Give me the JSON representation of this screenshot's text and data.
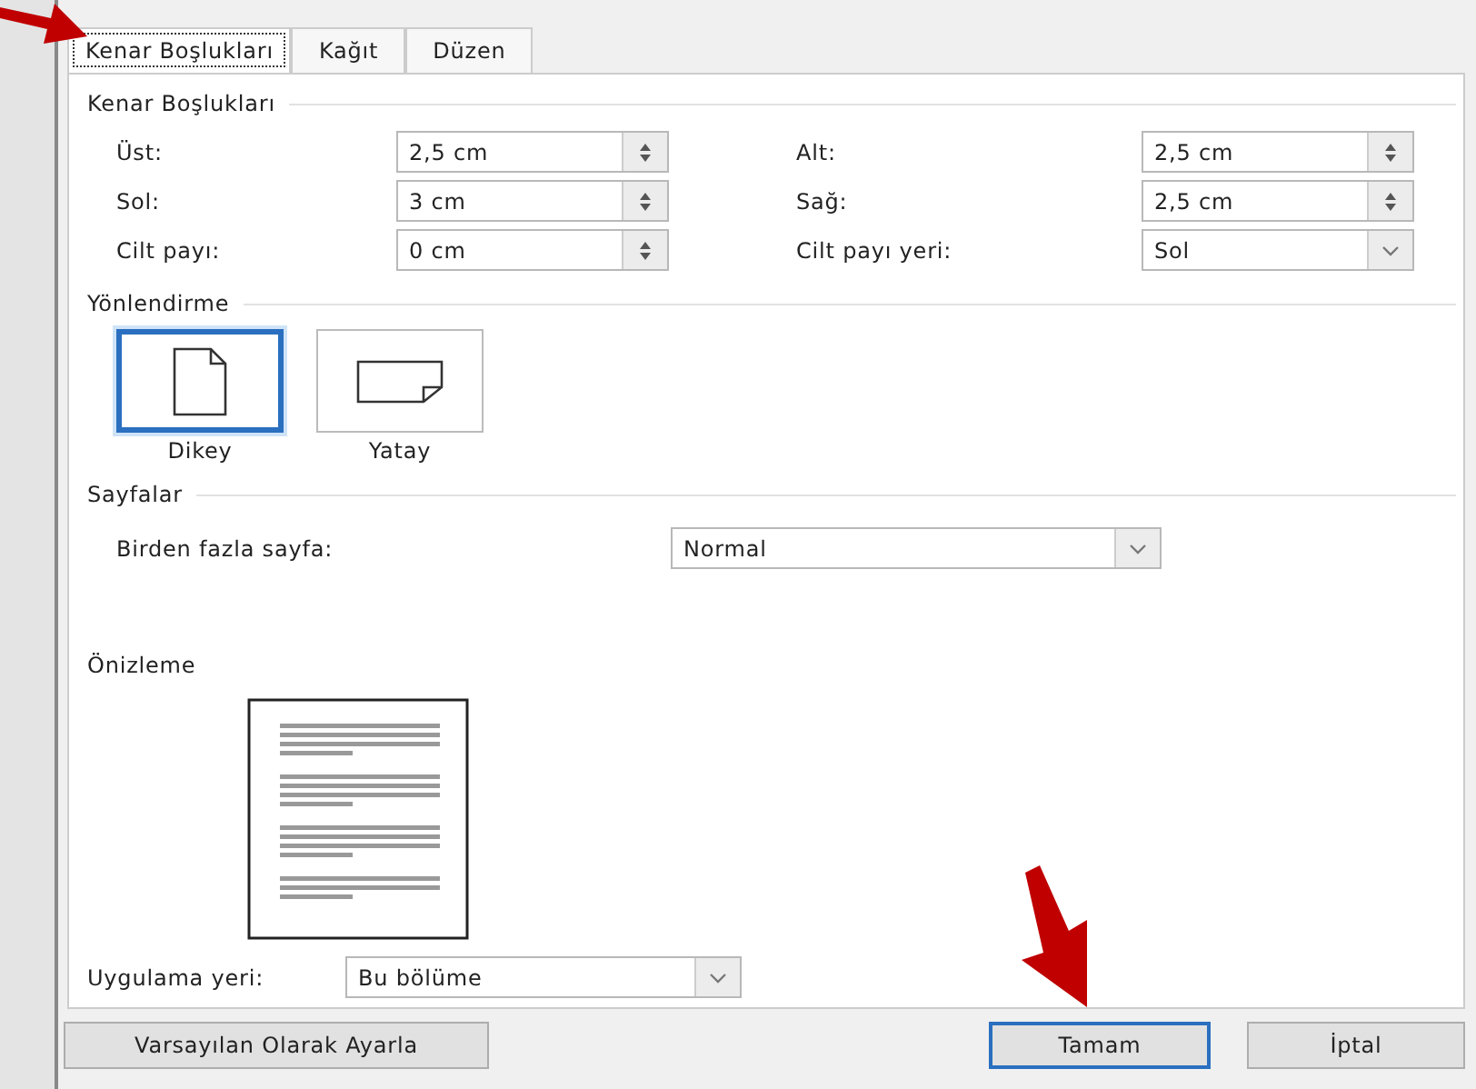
{
  "tabs": [
    {
      "label": "Kenar Boşlukları",
      "selected": true
    },
    {
      "label": "Kağıt",
      "selected": false
    },
    {
      "label": "Düzen",
      "selected": false
    }
  ],
  "margins": {
    "heading": "Kenar Boşlukları",
    "fields": [
      {
        "label": "Üst:",
        "value": "2,5 cm",
        "kind": "spin"
      },
      {
        "label": "Alt:",
        "value": "2,5 cm",
        "kind": "spin"
      },
      {
        "label": "Sol:",
        "value": "3 cm",
        "kind": "spin"
      },
      {
        "label": "Sağ:",
        "value": "2,5 cm",
        "kind": "spin"
      },
      {
        "label": "Cilt payı:",
        "value": "0 cm",
        "kind": "spin"
      },
      {
        "label": "Cilt payı yeri:",
        "value": "Sol",
        "kind": "dropdown"
      }
    ]
  },
  "orientation": {
    "heading": "Yönlendirme",
    "options": [
      {
        "label": "Dikey",
        "kind": "portrait",
        "selected": true
      },
      {
        "label": "Yatay",
        "kind": "landscape",
        "selected": false
      }
    ]
  },
  "pages": {
    "heading": "Sayfalar",
    "label": "Birden fazla sayfa:",
    "value": "Normal"
  },
  "preview": {
    "heading": "Önizleme"
  },
  "apply_to": {
    "label": "Uygulama yeri:",
    "value": "Bu bölüme"
  },
  "buttons": [
    {
      "label": "Varsayılan Olarak Ayarla",
      "kind": "secondary"
    },
    {
      "label": "Tamam",
      "kind": "default"
    },
    {
      "label": "İptal",
      "kind": "normal"
    }
  ]
}
